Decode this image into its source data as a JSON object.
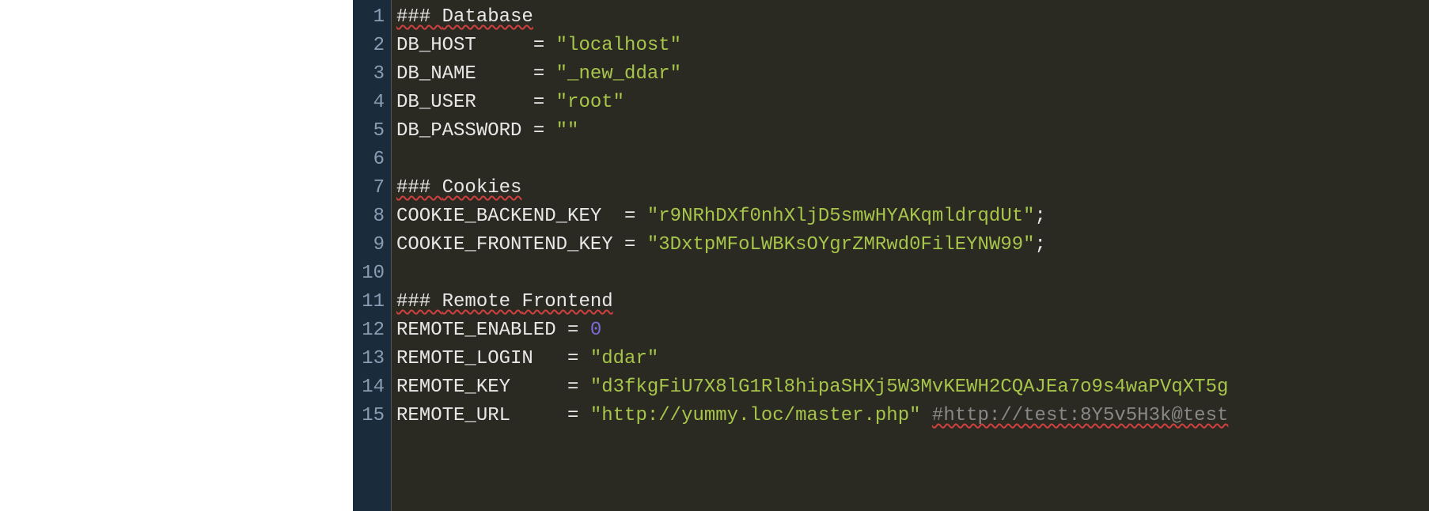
{
  "lines": [
    {
      "n": 1,
      "tokens": [
        {
          "t": "### ",
          "c": "tok-plain",
          "sp": "spell"
        },
        {
          "t": "Database",
          "c": "tok-plain",
          "sp": "spell"
        }
      ]
    },
    {
      "n": 2,
      "tokens": [
        {
          "t": "DB_HOST     = ",
          "c": "tok-plain"
        },
        {
          "t": "\"localhost\"",
          "c": "tok-string"
        }
      ]
    },
    {
      "n": 3,
      "tokens": [
        {
          "t": "DB_NAME     = ",
          "c": "tok-plain"
        },
        {
          "t": "\"_new_ddar\"",
          "c": "tok-string"
        }
      ]
    },
    {
      "n": 4,
      "tokens": [
        {
          "t": "DB_USER     = ",
          "c": "tok-plain"
        },
        {
          "t": "\"root\"",
          "c": "tok-string"
        }
      ]
    },
    {
      "n": 5,
      "tokens": [
        {
          "t": "DB_PASSWORD = ",
          "c": "tok-plain"
        },
        {
          "t": "\"\"",
          "c": "tok-string"
        }
      ]
    },
    {
      "n": 6,
      "tokens": []
    },
    {
      "n": 7,
      "tokens": [
        {
          "t": "### ",
          "c": "tok-plain",
          "sp": "spell"
        },
        {
          "t": "Cookies",
          "c": "tok-plain",
          "sp": "spell"
        }
      ]
    },
    {
      "n": 8,
      "tokens": [
        {
          "t": "COOKIE_BACKEND_KEY  = ",
          "c": "tok-plain"
        },
        {
          "t": "\"r9NRhDXf0nhXljD5smwHYAKqmldrqdUt\"",
          "c": "tok-string"
        },
        {
          "t": ";",
          "c": "tok-plain"
        }
      ]
    },
    {
      "n": 9,
      "tokens": [
        {
          "t": "COOKIE_FRONTEND_KEY = ",
          "c": "tok-plain"
        },
        {
          "t": "\"3DxtpMFoLWBKsOYgrZMRwd0FilEYNW99\"",
          "c": "tok-string"
        },
        {
          "t": ";",
          "c": "tok-plain"
        }
      ]
    },
    {
      "n": 10,
      "tokens": []
    },
    {
      "n": 11,
      "tokens": [
        {
          "t": "### ",
          "c": "tok-plain",
          "sp": "spell"
        },
        {
          "t": "Remote ",
          "c": "tok-plain",
          "sp": "spell"
        },
        {
          "t": "Frontend",
          "c": "tok-plain",
          "sp": "spell"
        }
      ]
    },
    {
      "n": 12,
      "tokens": [
        {
          "t": "REMOTE_ENABLED = ",
          "c": "tok-plain"
        },
        {
          "t": "0",
          "c": "tok-number"
        }
      ]
    },
    {
      "n": 13,
      "tokens": [
        {
          "t": "REMOTE_LOGIN   = ",
          "c": "tok-plain"
        },
        {
          "t": "\"ddar\"",
          "c": "tok-string"
        }
      ]
    },
    {
      "n": 14,
      "tokens": [
        {
          "t": "REMOTE_KEY     = ",
          "c": "tok-plain"
        },
        {
          "t": "\"d3fkgFiU7X8lG1Rl8hipaSHXj5W3MvKEWH2CQAJEa7o9s4waPVqXT5g",
          "c": "tok-string"
        }
      ]
    },
    {
      "n": 15,
      "tokens": [
        {
          "t": "REMOTE_URL     = ",
          "c": "tok-plain"
        },
        {
          "t": "\"http://yummy.loc/master.php\"",
          "c": "tok-string"
        },
        {
          "t": " ",
          "c": "tok-plain"
        },
        {
          "t": "#http://test:8Y5v5H3k@test",
          "c": "tok-comment",
          "sp": "spell"
        }
      ]
    }
  ]
}
